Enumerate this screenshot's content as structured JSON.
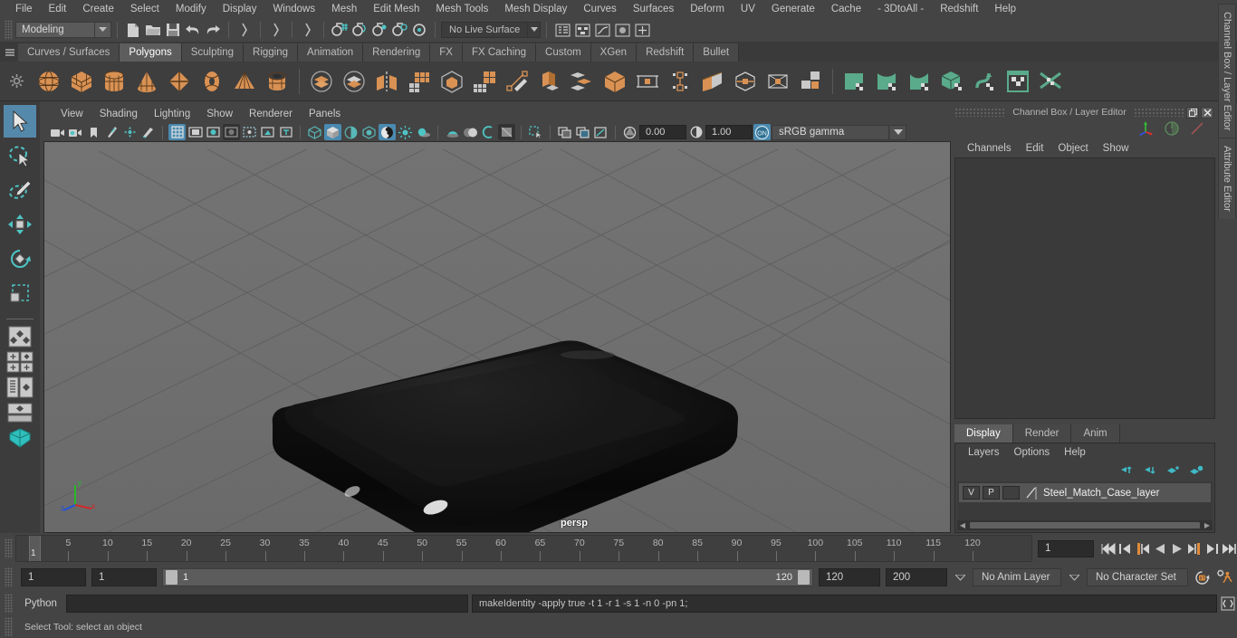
{
  "menubar": {
    "items": [
      "File",
      "Edit",
      "Create",
      "Select",
      "Modify",
      "Display",
      "Windows",
      "Mesh",
      "Edit Mesh",
      "Mesh Tools",
      "Mesh Display",
      "Curves",
      "Surfaces",
      "Deform",
      "UV",
      "Generate",
      "Cache",
      "- 3DtoAll -",
      "Redshift",
      "Help"
    ]
  },
  "statusline": {
    "menu_set": "Modeling",
    "live_surface": "No Live Surface"
  },
  "shelf_tabs": {
    "items": [
      "Curves / Surfaces",
      "Polygons",
      "Sculpting",
      "Rigging",
      "Animation",
      "Rendering",
      "FX",
      "FX Caching",
      "Custom",
      "XGen",
      "Redshift",
      "Bullet"
    ],
    "active": "Polygons"
  },
  "shelf_icons": [
    {
      "name": "poly-sphere-icon"
    },
    {
      "name": "poly-cube-icon"
    },
    {
      "name": "poly-cylinder-icon"
    },
    {
      "name": "poly-cone-icon"
    },
    {
      "name": "poly-plane-icon"
    },
    {
      "name": "poly-torus-icon"
    },
    {
      "name": "poly-pyramid-icon"
    },
    {
      "name": "poly-pipe-icon"
    },
    {
      "name": "combine-icon"
    },
    {
      "name": "separate-icon"
    },
    {
      "name": "mirror-geometry-icon"
    },
    {
      "name": "extract-icon"
    },
    {
      "name": "booleans-icon"
    },
    {
      "name": "smooth-icon"
    },
    {
      "name": "create-polygon-tool-icon"
    },
    {
      "name": "extrude-icon"
    },
    {
      "name": "bevel-icon"
    },
    {
      "name": "merge-icon"
    },
    {
      "name": "fill-hole-icon"
    },
    {
      "name": "bridge-icon"
    },
    {
      "name": "append-polygon-icon"
    },
    {
      "name": "multi-cut-icon"
    },
    {
      "name": "target-weld-icon"
    },
    {
      "name": "quad-draw-icon"
    },
    {
      "name": "uv-planar-icon"
    },
    {
      "name": "uv-cylindrical-icon"
    },
    {
      "name": "uv-spherical-icon"
    },
    {
      "name": "uv-automatic-icon"
    },
    {
      "name": "uv-unfold-icon"
    },
    {
      "name": "uv-editor-icon"
    },
    {
      "name": "uv-cut-sew-icon"
    }
  ],
  "toolbox": {
    "items": [
      {
        "name": "select-tool",
        "selected": true
      },
      {
        "name": "lasso-select-tool",
        "selected": false
      },
      {
        "name": "paint-select-tool",
        "selected": false
      },
      {
        "name": "move-tool",
        "selected": false
      },
      {
        "name": "rotate-tool",
        "selected": false
      },
      {
        "name": "scale-tool",
        "selected": false
      },
      {
        "name": "last-tool-used",
        "selected": false
      }
    ],
    "layouts": [
      {
        "name": "single-perspective-layout"
      },
      {
        "name": "four-view-layout"
      },
      {
        "name": "outliner-persp-layout"
      },
      {
        "name": "persp-graph-layout"
      },
      {
        "name": "hypershade-layout"
      }
    ]
  },
  "viewport": {
    "panel_menus": [
      "View",
      "Shading",
      "Lighting",
      "Show",
      "Renderer",
      "Panels"
    ],
    "toolbar": {
      "exposure_value": "0.00",
      "gamma_value": "1.00",
      "color_space": "sRGB gamma",
      "view_transform_toggle": "ON"
    },
    "camera_label": "persp",
    "axis_labels": {
      "x": "x",
      "y": "y",
      "z": "z"
    },
    "colors": {
      "background": "#6e6e6e",
      "grid_line": "#5b5b5b",
      "object": "#101010",
      "x_axis": "#e02020",
      "y_axis": "#22c022",
      "z_axis": "#2050e0"
    }
  },
  "channel_box": {
    "panel_title": "Channel Box / Layer Editor",
    "menus": [
      "Channels",
      "Edit",
      "Object",
      "Show"
    ],
    "side_tabs": [
      "Channel Box / Layer Editor",
      "Attribute Editor"
    ],
    "top_icons": [
      {
        "name": "show-manipulator-icon"
      },
      {
        "name": "channel-box-toggle-icon"
      },
      {
        "name": "attribute-editor-toggle-icon"
      }
    ]
  },
  "layer_editor": {
    "tabs": [
      "Display",
      "Render",
      "Anim"
    ],
    "active_tab": "Display",
    "menus": [
      "Layers",
      "Options",
      "Help"
    ],
    "toolbar_icons": [
      {
        "name": "move-layer-up-icon"
      },
      {
        "name": "move-layer-down-icon"
      },
      {
        "name": "create-new-layer-icon"
      },
      {
        "name": "create-layer-from-selected-icon"
      }
    ],
    "layers": [
      {
        "visibility": "V",
        "playback": "P",
        "shading": "",
        "name": "Steel_Match_Case_layer"
      }
    ]
  },
  "timeline": {
    "ticks": [
      5,
      10,
      15,
      20,
      25,
      30,
      35,
      40,
      45,
      50,
      55,
      60,
      65,
      70,
      75,
      80,
      85,
      90,
      95,
      100,
      105,
      110,
      115,
      120
    ],
    "current_frame": "1",
    "current_frame_field": "1",
    "playback_buttons": [
      {
        "name": "go-to-start-button"
      },
      {
        "name": "step-back-frame-button"
      },
      {
        "name": "step-back-key-button"
      },
      {
        "name": "play-backwards-button"
      },
      {
        "name": "play-forwards-button"
      },
      {
        "name": "step-forward-key-button"
      },
      {
        "name": "step-forward-frame-button"
      },
      {
        "name": "go-to-end-button"
      }
    ]
  },
  "range_slider": {
    "anim_start": "1",
    "range_start": "1",
    "slider_start_label": "1",
    "slider_end_label": "120",
    "range_end": "120",
    "anim_end": "200",
    "anim_layer": "No Anim Layer",
    "character_set": "No Character Set",
    "buttons": [
      {
        "name": "auto-keyframe-toggle"
      },
      {
        "name": "animation-preferences-button"
      }
    ]
  },
  "command_line": {
    "language_label": "Python",
    "input_value": "",
    "output_value": "makeIdentity -apply true -t 1 -r 1 -s 1 -n 0 -pn 1;",
    "script_editor_button": "script-editor-icon"
  },
  "help_line": {
    "text": "Select Tool: select an object"
  }
}
